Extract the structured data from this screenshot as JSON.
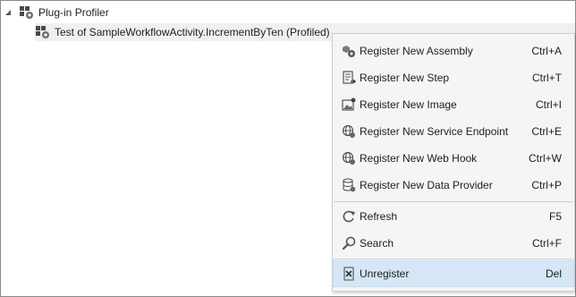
{
  "tree": {
    "root_label": "Plug-in Profiler",
    "child_label": "Test of SampleWorkflowActivity.IncrementByTen (Profiled)"
  },
  "context_menu": {
    "items": [
      {
        "label": "Register New Assembly",
        "shortcut": "Ctrl+A",
        "icon": "assembly-icon"
      },
      {
        "label": "Register New Step",
        "shortcut": "Ctrl+T",
        "icon": "step-icon"
      },
      {
        "label": "Register New Image",
        "shortcut": "Ctrl+I",
        "icon": "image-icon"
      },
      {
        "label": "Register New Service Endpoint",
        "shortcut": "Ctrl+E",
        "icon": "service-endpoint-icon"
      },
      {
        "label": "Register New Web Hook",
        "shortcut": "Ctrl+W",
        "icon": "web-hook-icon"
      },
      {
        "label": "Register New Data Provider",
        "shortcut": "Ctrl+P",
        "icon": "data-provider-icon"
      },
      {
        "label": "Refresh",
        "shortcut": "F5",
        "icon": "refresh-icon"
      },
      {
        "label": "Search",
        "shortcut": "Ctrl+F",
        "icon": "search-icon"
      },
      {
        "label": "Unregister",
        "shortcut": "Del",
        "icon": "unregister-icon"
      }
    ],
    "highlighted_item": "Unregister"
  },
  "colors": {
    "menu_background": "#f5f5f5",
    "highlight": "#d5e6f7",
    "selected_row": "#f0f0f0"
  }
}
